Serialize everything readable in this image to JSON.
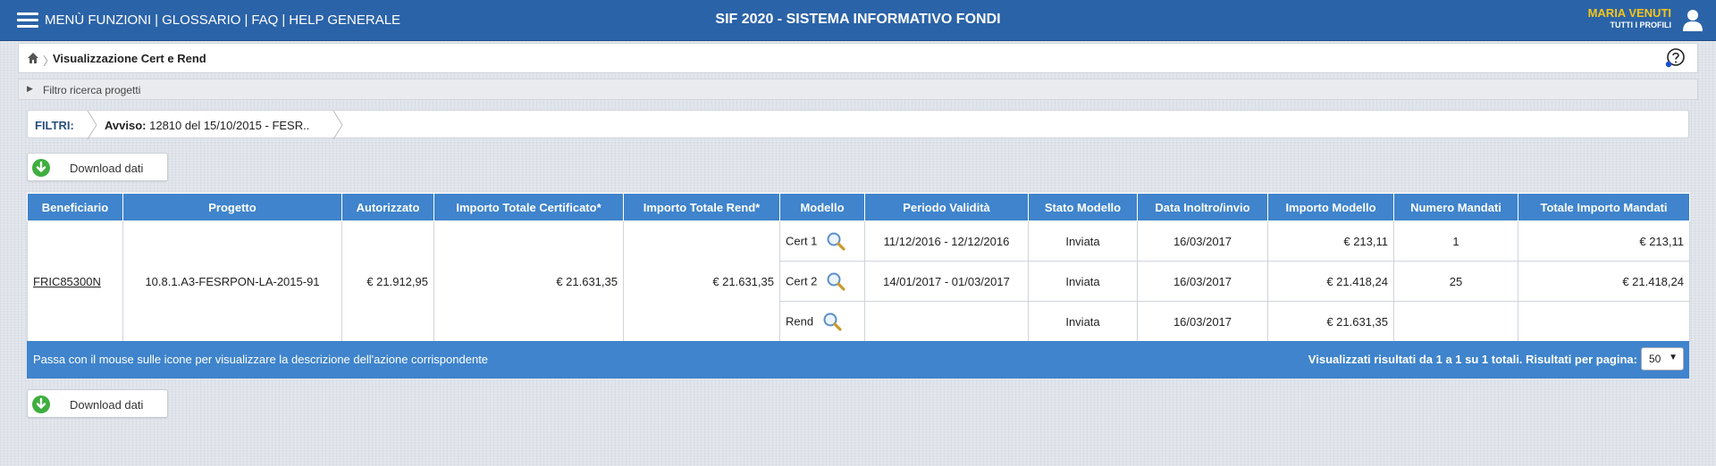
{
  "header": {
    "menu": [
      "MENÙ FUNZIONI",
      "GLOSSARIO",
      "FAQ",
      "HELP GENERALE"
    ],
    "title": "SIF 2020 - SISTEMA INFORMATIVO FONDI",
    "user_name": "MARIA VENUTI",
    "user_role": "TUTTI I PROFILI"
  },
  "breadcrumb": {
    "separator": "〉",
    "page_title": "Visualizzazione Cert e Rend"
  },
  "filter_panel": {
    "label": "Filtro ricerca progetti"
  },
  "filters": {
    "label": "FILTRI:",
    "avviso_key": "Avviso:",
    "avviso_value": "12810 del 15/10/2015 - FESR.."
  },
  "actions": {
    "download_label": "Download dati"
  },
  "table": {
    "columns": [
      "Beneficiario",
      "Progetto",
      "Autorizzato",
      "Importo Totale Certificato*",
      "Importo Totale Rend*",
      "Modello",
      "Periodo Validità",
      "Stato Modello",
      "Data Inoltro/invio",
      "Importo Modello",
      "Numero Mandati",
      "Totale Importo Mandati"
    ],
    "beneficiario": "FRIC85300N",
    "progetto": "10.8.1.A3-FESRPON-LA-2015-91",
    "autorizzato": "€ 21.912,95",
    "importo_certificato": "€ 21.631,35",
    "importo_rend": "€ 21.631,35",
    "rows": [
      {
        "modello": "Cert 1",
        "periodo": "11/12/2016 - 12/12/2016",
        "stato": "Inviata",
        "data": "16/03/2017",
        "importo": "€ 213,11",
        "mandati": "1",
        "totale": "€ 213,11"
      },
      {
        "modello": "Cert 2",
        "periodo": "14/01/2017 - 01/03/2017",
        "stato": "Inviata",
        "data": "16/03/2017",
        "importo": "€ 21.418,24",
        "mandati": "25",
        "totale": "€ 21.418,24"
      },
      {
        "modello": "Rend",
        "periodo": "",
        "stato": "Inviata",
        "data": "16/03/2017",
        "importo": "€ 21.631,35",
        "mandati": "",
        "totale": ""
      }
    ]
  },
  "footer": {
    "hint": "Passa con il mouse sulle icone per visualizzare la descrizione dell'azione corrispondente",
    "results": "Visualizzati risultati da 1 a 1 su 1 totali. Risultati per pagina:",
    "page_size": "50",
    "dropdown_glyph": "▼"
  },
  "icons": {
    "hamburger": "hamburger-menu-icon",
    "user": "user-icon",
    "home": "home-icon",
    "help": "help-icon",
    "download": "download-arrow-icon",
    "view": "magnifier-icon"
  },
  "colors": {
    "topbar": "#2b63a8",
    "table_header": "#3f84cc",
    "user_name": "#f5c518",
    "download_green": "#3fae3f"
  }
}
